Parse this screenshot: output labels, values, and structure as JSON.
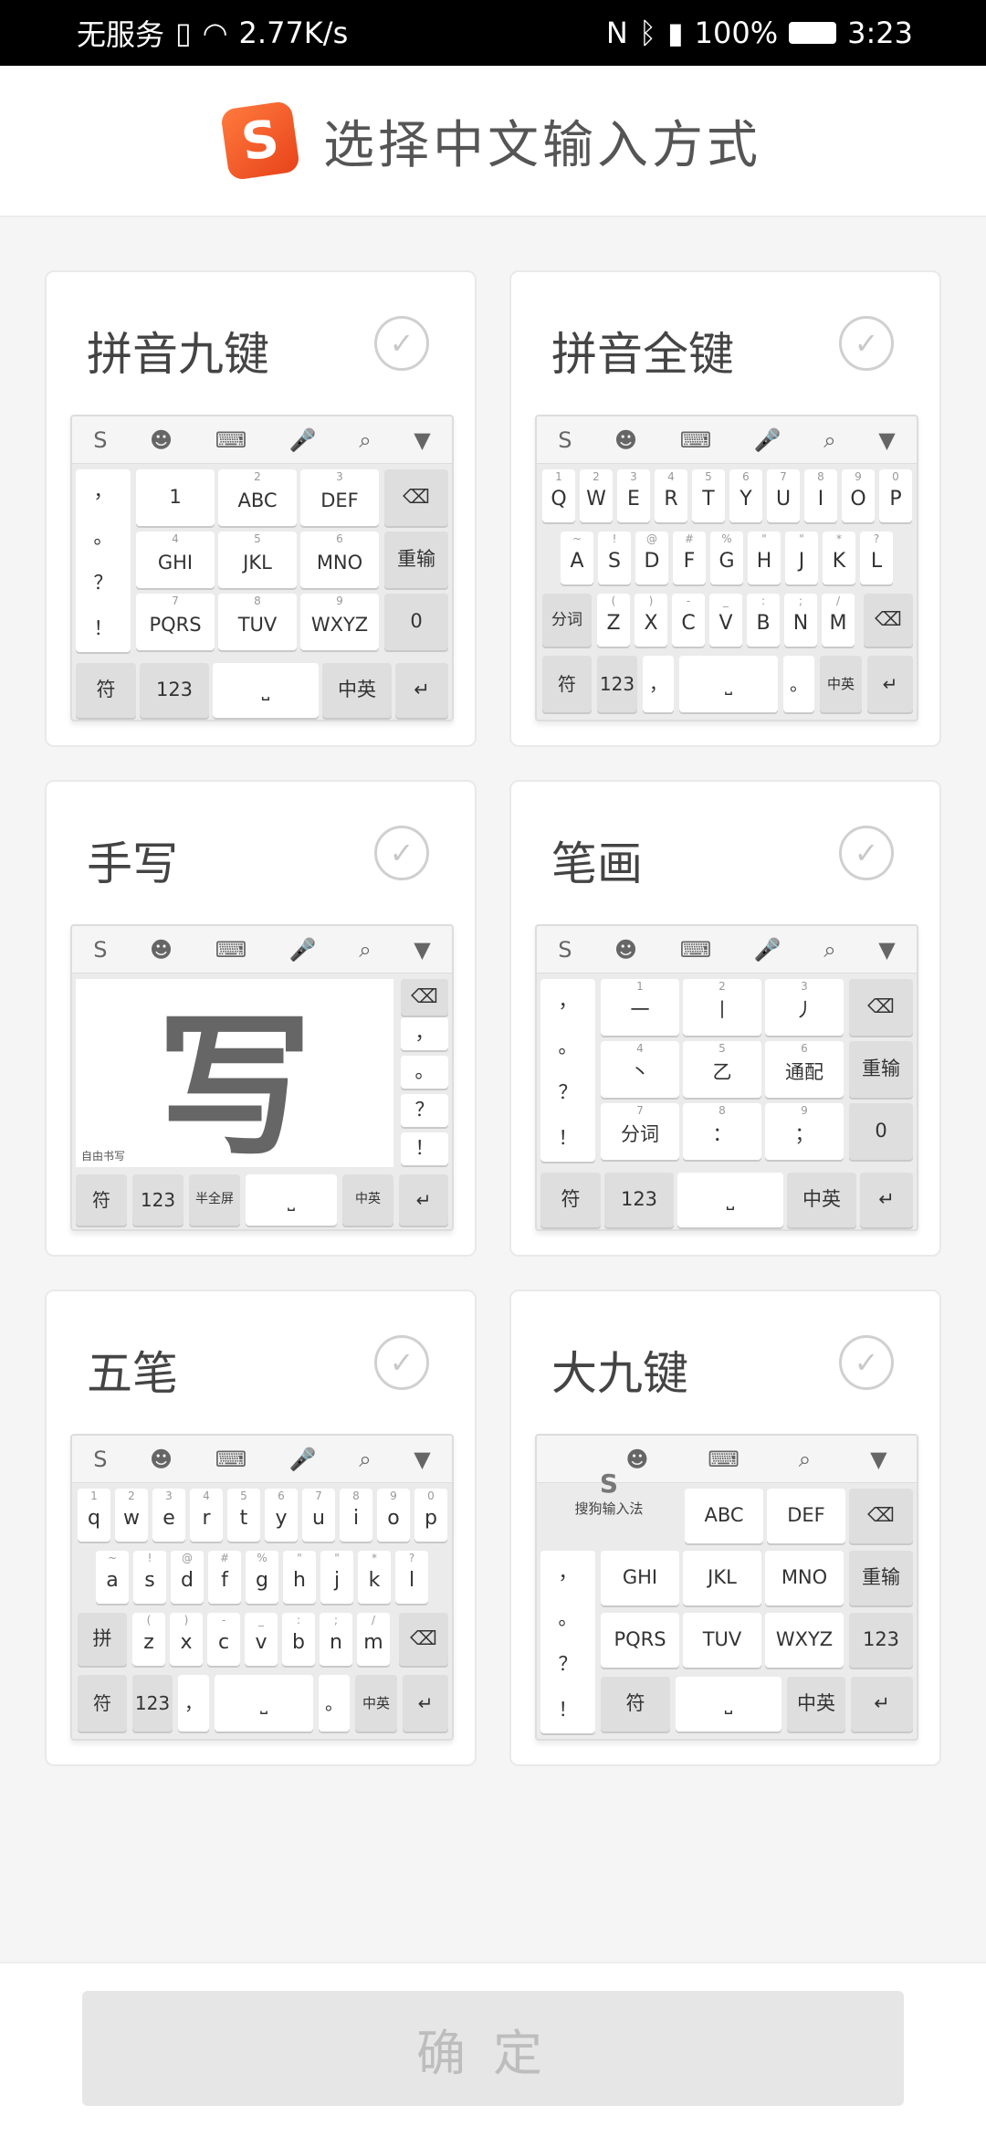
{
  "status": {
    "carrier": "无服务",
    "speed": "2.77K/s",
    "battery": "100%",
    "time": "3:23"
  },
  "header": {
    "logo": "S",
    "title": "选择中文输入方式"
  },
  "cards": {
    "c1": {
      "name": "拼音九键"
    },
    "c2": {
      "name": "拼音全键"
    },
    "c3": {
      "name": "手写"
    },
    "c4": {
      "name": "笔画"
    },
    "c5": {
      "name": "五笔"
    },
    "c6": {
      "name": "大九键"
    }
  },
  "check_glyph": "✓",
  "toolbar": {
    "logo": "S",
    "emoji": "☻",
    "kbd": "⌨",
    "mic": "🎤",
    "search": "⌕",
    "down": "▼"
  },
  "pinyin9": {
    "side": [
      "，",
      "。",
      "？",
      "！"
    ],
    "keys": [
      {
        "t": "1",
        "s": ""
      },
      {
        "t": "ABC",
        "s": "2"
      },
      {
        "t": "DEF",
        "s": "3"
      },
      {
        "t": "GHI",
        "s": "4"
      },
      {
        "t": "JKL",
        "s": "5"
      },
      {
        "t": "MNO",
        "s": "6"
      },
      {
        "t": "PQRS",
        "s": "7"
      },
      {
        "t": "TUV",
        "s": "8"
      },
      {
        "t": "WXYZ",
        "s": "9"
      }
    ],
    "right": [
      "⌫",
      "重输",
      "0"
    ],
    "bottom": [
      "符",
      "123",
      "⎵",
      "中英",
      "↵"
    ]
  },
  "qwerty": {
    "row1": [
      {
        "t": "Q",
        "s": "1"
      },
      {
        "t": "W",
        "s": "2"
      },
      {
        "t": "E",
        "s": "3"
      },
      {
        "t": "R",
        "s": "4"
      },
      {
        "t": "T",
        "s": "5"
      },
      {
        "t": "Y",
        "s": "6"
      },
      {
        "t": "U",
        "s": "7"
      },
      {
        "t": "I",
        "s": "8"
      },
      {
        "t": "O",
        "s": "9"
      },
      {
        "t": "P",
        "s": "0"
      }
    ],
    "row2": [
      {
        "t": "A",
        "s": "~"
      },
      {
        "t": "S",
        "s": "!"
      },
      {
        "t": "D",
        "s": "@"
      },
      {
        "t": "F",
        "s": "#"
      },
      {
        "t": "G",
        "s": "%"
      },
      {
        "t": "H",
        "s": "\""
      },
      {
        "t": "J",
        "s": "\""
      },
      {
        "t": "K",
        "s": "*"
      },
      {
        "t": "L",
        "s": "?"
      }
    ],
    "row3": [
      {
        "t": "Z",
        "s": "("
      },
      {
        "t": "X",
        "s": ")"
      },
      {
        "t": "C",
        "s": "-"
      },
      {
        "t": "V",
        "s": "_"
      },
      {
        "t": "B",
        "s": ":"
      },
      {
        "t": "N",
        "s": ";"
      },
      {
        "t": "M",
        "s": "/"
      }
    ],
    "fenci": "分词",
    "del": "⌫",
    "bottom": [
      "符",
      "123",
      "，",
      "⎵",
      "。",
      "中英",
      "↵"
    ]
  },
  "hand": {
    "char": "写",
    "label": "自由书写",
    "side": [
      "⌫",
      "，",
      "。",
      "？",
      "！"
    ],
    "bottom": [
      "符",
      "123",
      "半全屏",
      "⎵",
      "中英",
      "↵"
    ]
  },
  "stroke": {
    "side": [
      "，",
      "。",
      "？",
      "！"
    ],
    "keys": [
      {
        "t": "一",
        "s": "1"
      },
      {
        "t": "丨",
        "s": "2"
      },
      {
        "t": "丿",
        "s": "3"
      },
      {
        "t": "丶",
        "s": "4"
      },
      {
        "t": "乙",
        "s": "5"
      },
      {
        "t": "通配",
        "s": "6"
      },
      {
        "t": "分词",
        "s": "7"
      },
      {
        "t": "：",
        "s": "8"
      },
      {
        "t": "；",
        "s": "9"
      }
    ],
    "right": [
      "⌫",
      "重输",
      "0"
    ],
    "bottom": [
      "符",
      "123",
      "⎵",
      "中英",
      "↵"
    ]
  },
  "wubi": {
    "row1": [
      {
        "t": "q",
        "s": "1"
      },
      {
        "t": "w",
        "s": "2"
      },
      {
        "t": "e",
        "s": "3"
      },
      {
        "t": "r",
        "s": "4"
      },
      {
        "t": "t",
        "s": "5"
      },
      {
        "t": "y",
        "s": "6"
      },
      {
        "t": "u",
        "s": "7"
      },
      {
        "t": "i",
        "s": "8"
      },
      {
        "t": "o",
        "s": "9"
      },
      {
        "t": "p",
        "s": "0"
      }
    ],
    "row2": [
      {
        "t": "a",
        "s": "~"
      },
      {
        "t": "s",
        "s": "!"
      },
      {
        "t": "d",
        "s": "@"
      },
      {
        "t": "f",
        "s": "#"
      },
      {
        "t": "g",
        "s": "%"
      },
      {
        "t": "h",
        "s": "\""
      },
      {
        "t": "j",
        "s": "\""
      },
      {
        "t": "k",
        "s": "*"
      },
      {
        "t": "l",
        "s": "?"
      }
    ],
    "row3": [
      {
        "t": "z",
        "s": "("
      },
      {
        "t": "x",
        "s": ")"
      },
      {
        "t": "c",
        "s": "-"
      },
      {
        "t": "v",
        "s": "_"
      },
      {
        "t": "b",
        "s": ":"
      },
      {
        "t": "n",
        "s": ";"
      },
      {
        "t": "m",
        "s": "/"
      }
    ],
    "pin": "拼",
    "del": "⌫",
    "bottom": [
      "符",
      "123",
      "，",
      "⎵",
      "。",
      "中英",
      "↵"
    ]
  },
  "big9": {
    "brand": "搜狗输入法",
    "side": [
      "，",
      "。",
      "？",
      "！"
    ],
    "keys": [
      "ABC",
      "DEF",
      "GHI",
      "JKL",
      "MNO",
      "PQRS",
      "TUV",
      "WXYZ"
    ],
    "right": [
      "⌫",
      "重输",
      "123"
    ],
    "bottom": [
      "符",
      "⎵",
      "中英",
      "↵"
    ]
  },
  "confirm": "确定"
}
